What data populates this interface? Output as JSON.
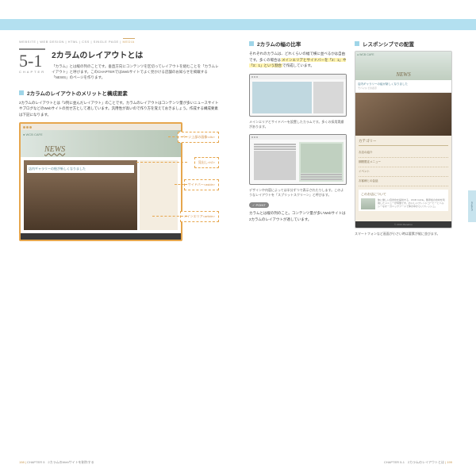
{
  "breadcrumb": [
    "WEBSITE",
    "WEB DESIGN",
    "HTML",
    "CSS",
    "SINGLE PAGE",
    "MEDIA"
  ],
  "chapter": {
    "num": "5-1",
    "label": "CHAPTER"
  },
  "title": "2カラムのレイアウトとは",
  "lead": "「カラム」とは縦の列のことです。垂直方向にコンテンツを区切ってレイアウトを組むことを「カラムレイアウト」と呼びます。このCHAPTERではWebサイトでよく見かける店舗のお知らせを掲載する「NEWS」のページを作ります。",
  "section1": {
    "title": "2カラムのレイアウトのメリットと構成要素",
    "body": "2カラムのレイアウトとは「2列に並んだレイアウト」のことです。カラムのレイアウトはコンテンツ量が多いニュースサイトやブログなどのWebサイトの見せ方として適しています。汎用性が高いので作り方を覚えておきましょう。作成する構成要素は下記になります。"
  },
  "mockup": {
    "logo": "● WCB CAFE",
    "news": "NEWS",
    "banner": "店内ギャラリーの絵が新しくなりました",
    "footer": "© 2019 Manabox"
  },
  "callouts": {
    "header": "ページ上部の画像<div>",
    "h2": "見出し<h2>",
    "aside": "サイドバー<aside>",
    "article": "メインエリア<article>"
  },
  "right": {
    "sec_ratio": {
      "title": "2カラムの幅の比率",
      "body1": "それぞれのカラムは、どれくらいの幅で横に並べるかは自由です。多くの場合は",
      "hl1": "メインエリアとサイドバーを「2：1」や「3：1」という割合",
      "body2": "で作成しています。"
    },
    "cap1": "メインエリアとサイドバーを設置したカラムです。多くの採用実績があります。",
    "cap2": "デザインや内容によっては半分ずつで表示されたりします。このようなレイアウトを「スプリットスクリーン」と呼びます。",
    "point": {
      "label": "POINT",
      "body": "カラムとは縦の列のこと。コンテンツ量が多いWebサイトは2カラムのレイアウトが適しています。"
    },
    "sec_resp": {
      "title": "レスポンシブでの配置"
    },
    "phone": {
      "notice": "店内ギャラリーの絵が新しくなりました",
      "notice_sub": "モバイルでの表示",
      "cat_title": "カテゴリー",
      "items": [
        "お店の紹介",
        "期間限定メニュー",
        "イベント",
        "お客様との会話"
      ],
      "about_title": "このお店について",
      "about_body": "体に優しい自然食を提供する、WCB CAFE。無添加の食材を利用したメニューが特徴です。おいしいプレンドコーヒーとヘルシーなオーガニックフードで体の中からリフレッシュ。"
    },
    "cap3": "スマートフォンなど画面が小さい時は要素が縦に並びます。"
  },
  "footers": {
    "left_pn": "198",
    "left_text": "CHAPTER 5　2カラムのWebサイトを制作する",
    "right_text": "CHAPTER 5-1　2カラムのレイアウトとは",
    "right_pn": "199"
  },
  "sidetab": "chapter5"
}
